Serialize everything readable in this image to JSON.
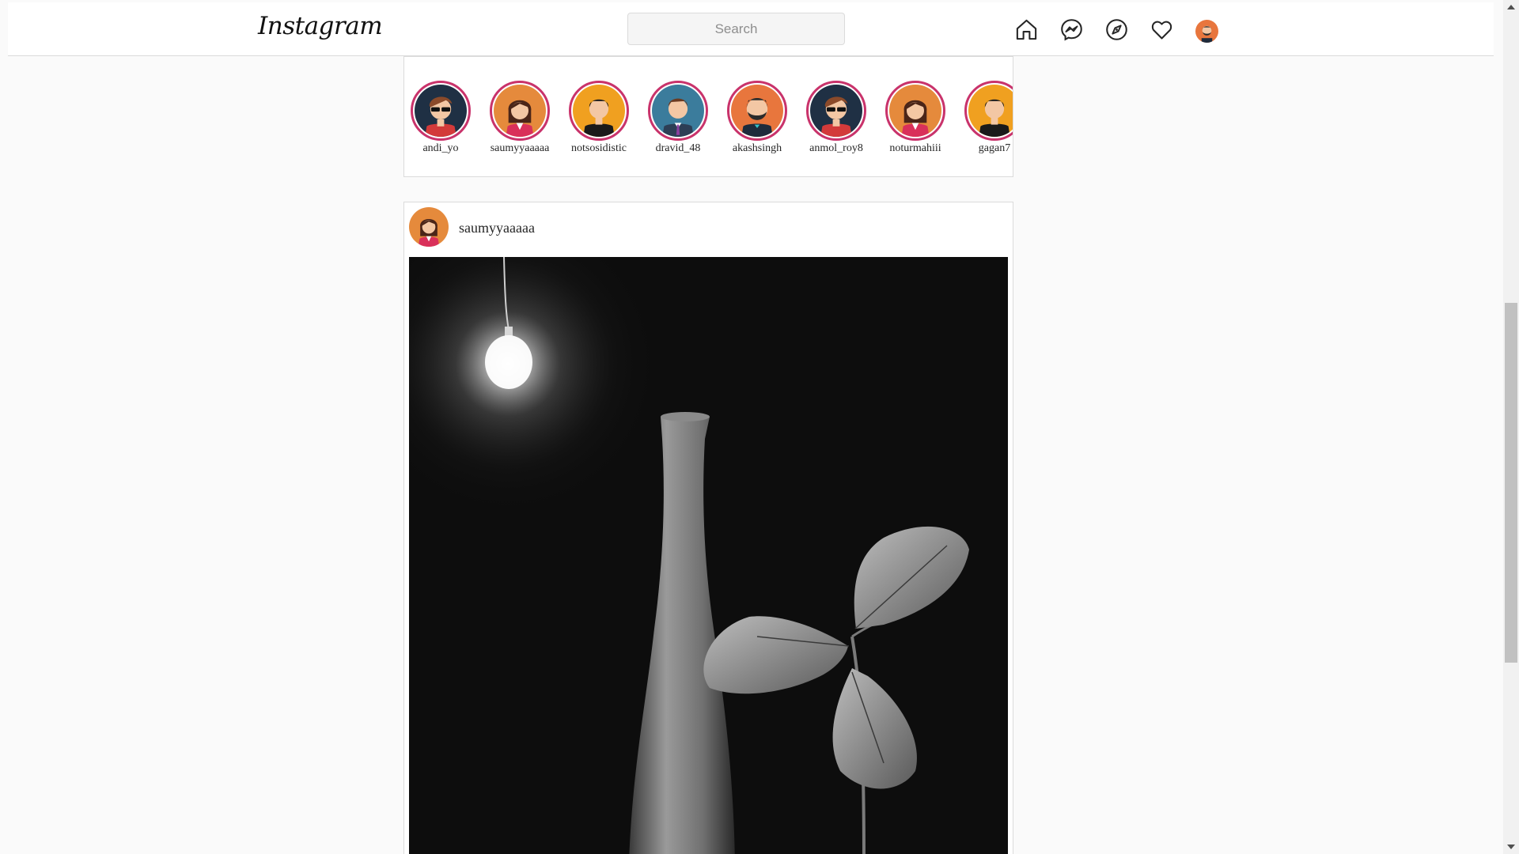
{
  "header": {
    "logo": "Instagram",
    "search_placeholder": "Search",
    "icons": [
      "home-icon",
      "messenger-icon",
      "explore-icon",
      "heart-icon",
      "profile-avatar"
    ]
  },
  "stories": [
    {
      "name": "andi_yo",
      "avatar": "sunglasses-man",
      "bg": "#1f3044"
    },
    {
      "name": "saumyyaaaaa",
      "avatar": "woman",
      "bg": "#e58a3c"
    },
    {
      "name": "notsosidistic",
      "avatar": "man-black-shirt",
      "bg": "#f0a020"
    },
    {
      "name": "dravid_48",
      "avatar": "man-suit",
      "bg": "#3b7c9c"
    },
    {
      "name": "akashsingh",
      "avatar": "bearded-man",
      "bg": "#e8763d"
    },
    {
      "name": "anmol_roy8",
      "avatar": "sunglasses-man",
      "bg": "#1f3044"
    },
    {
      "name": "noturmahiii",
      "avatar": "woman",
      "bg": "#e58a3c"
    },
    {
      "name": "gagan7",
      "avatar": "man-black-shirt",
      "bg": "#f0a020"
    }
  ],
  "post": {
    "username": "saumyyaaaaa",
    "image_desc_icon": "vase-with-leaves-photo"
  },
  "colors": {
    "story_ring": "#c9336b",
    "border": "#dbdbdb",
    "background": "#fafafa"
  }
}
